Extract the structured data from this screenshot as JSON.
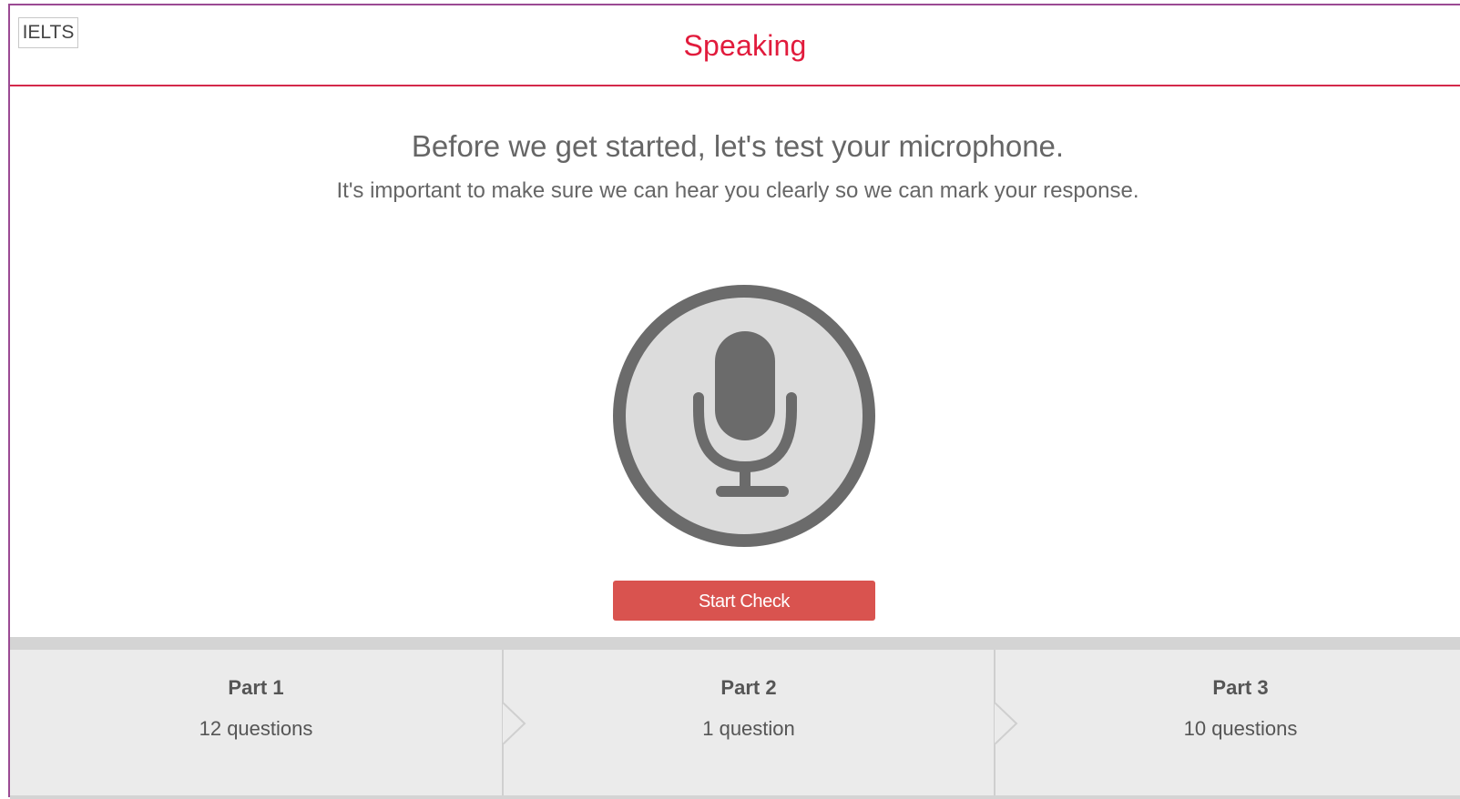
{
  "header": {
    "logo_text": "IELTS",
    "title": "Speaking"
  },
  "intro": {
    "heading": "Before we get started, let's test your microphone.",
    "subheading": "It's important to make sure we can hear you clearly so we can mark your response."
  },
  "mic": {
    "icon": "microphone-icon"
  },
  "actions": {
    "start_check_label": "Start Check"
  },
  "parts": [
    {
      "name": "Part 1",
      "count": "12 questions"
    },
    {
      "name": "Part 2",
      "count": "1 question"
    },
    {
      "name": "Part 3",
      "count": "10 questions"
    }
  ],
  "colors": {
    "accent": "#e11b3c",
    "button": "#d9534f",
    "icon": "#6b6b6b",
    "frame": "#9b4a93"
  }
}
